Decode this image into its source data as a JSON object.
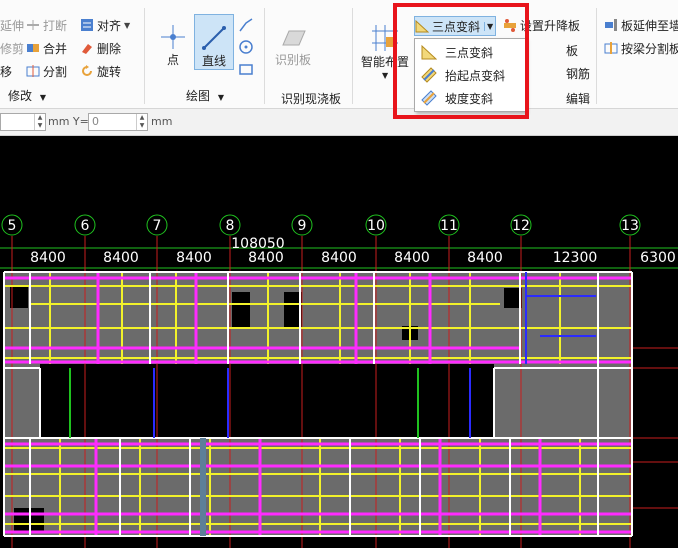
{
  "ribbon": {
    "modify": {
      "items": [
        "延伸",
        "打断",
        "对齐",
        "修剪",
        "合并",
        "删除",
        "移",
        "分割",
        "旋转"
      ],
      "label": "修改"
    },
    "draw": {
      "point_label": "点",
      "line_label": "直线",
      "label": "绘图"
    },
    "recognize": {
      "button_label": "识别板",
      "label": "识别现浇板"
    },
    "smart_layout_label": "智能布置",
    "slab": {
      "three_point_slope": "三点变斜",
      "set_raise_lower": "设置升降板",
      "partial_board": "板",
      "partial_rebar": "钢筋",
      "partial_edit": "编辑",
      "extend_slab": "板延伸至墙",
      "split_by_beam": "按梁分割板"
    }
  },
  "dropdown": {
    "items": [
      "三点变斜",
      "抬起点变斜",
      "坡度变斜"
    ]
  },
  "coords": {
    "x_value": "",
    "x_unit": "mm Y=",
    "y_value": "0",
    "y_unit": "mm"
  },
  "axes": {
    "labels": [
      "5",
      "6",
      "7",
      "8",
      "9",
      "10",
      "11",
      "12",
      "13"
    ],
    "total_dim": "108050",
    "dims": [
      "8400",
      "8400",
      "8400",
      "8400",
      "8400",
      "8400",
      "8400",
      "12300",
      "6300"
    ]
  },
  "colors": {
    "highlight": "#e8141b",
    "canvas_bg": "#000000",
    "axis_green": "#1fc21f",
    "slab_gray": "#6b6b6b",
    "beam_yellow": "#f2f22a",
    "beam_magenta": "#ff2bff",
    "beam_white": "#ffffff",
    "grid_red": "#c81e1e"
  }
}
